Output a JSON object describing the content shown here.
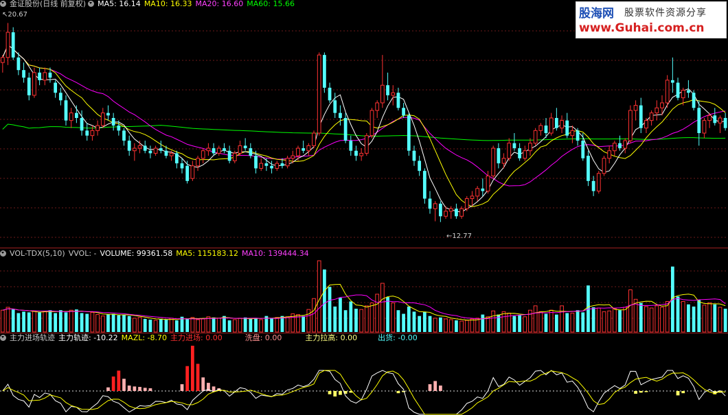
{
  "header_main": {
    "title": "金证股份(日线 前复权)",
    "ma5": "MA5: 16.14",
    "ma10": "MA10: 16.33",
    "ma20": "MA20: 16.60",
    "ma60": "MA60: 15.66"
  },
  "header_vol": {
    "title": "VOL-TDX(5,10)",
    "vvol": "VVOL: -",
    "volume": "VOLUME: 99361.58",
    "ma5": "MA5: 115183.12",
    "ma10": "MA10: 139444.34"
  },
  "header_ind": {
    "title": "主力进场轨迹",
    "track": "主力轨迹: -10.22",
    "mazl": "MAZL: -8.70",
    "enter": "主力进场: 0.00",
    "wash": "洗盘: 0.00",
    "pull": "主力拉高: 0.00",
    "exit": "出货: -0.00"
  },
  "logo": {
    "name": "股海网",
    "slogan": "股票软件资源分享",
    "url": "www.Guhai.com.cn"
  },
  "colors": {
    "background": "#000000",
    "up": "#ff3232",
    "down": "#54ffff",
    "ma5": "#ffffff",
    "ma10": "#ffff00",
    "ma20": "#ff00ff",
    "ma60": "#00ff00",
    "grid": "#6e1a1a",
    "enter_bar": "#ff2020",
    "wash_bar": "#ffb0b0",
    "pull_bar": "#ffff80",
    "exit_bar": "#ffff66"
  },
  "chart_data": {
    "type": "candlestick",
    "max_label": "20.67",
    "min_label": "12.77",
    "price_range": [
      12.0,
      21.2
    ],
    "candles": [
      [
        19.1,
        19.4,
        18.7,
        19.3
      ],
      [
        19.3,
        20.67,
        19.0,
        20.3
      ],
      [
        20.3,
        20.5,
        19.2,
        19.3
      ],
      [
        19.3,
        19.5,
        18.6,
        18.8
      ],
      [
        18.8,
        19.1,
        18.3,
        18.5
      ],
      [
        18.5,
        18.7,
        17.6,
        17.8
      ],
      [
        17.8,
        18.9,
        17.7,
        18.7
      ],
      [
        18.7,
        18.9,
        18.2,
        18.4
      ],
      [
        18.4,
        18.9,
        18.2,
        18.7
      ],
      [
        18.7,
        18.9,
        18.3,
        18.5
      ],
      [
        18.3,
        18.4,
        17.7,
        17.9
      ],
      [
        17.9,
        18.1,
        17.4,
        17.6
      ],
      [
        17.6,
        17.8,
        16.6,
        16.8
      ],
      [
        16.8,
        17.3,
        16.5,
        17.1
      ],
      [
        17.1,
        17.4,
        16.7,
        16.9
      ],
      [
        16.9,
        17.2,
        16.2,
        16.4
      ],
      [
        16.4,
        16.7,
        16.0,
        16.2
      ],
      [
        16.2,
        16.6,
        16.0,
        16.4
      ],
      [
        16.4,
        16.8,
        16.2,
        16.6
      ],
      [
        16.6,
        17.3,
        16.5,
        17.1
      ],
      [
        17.1,
        17.4,
        16.8,
        17.0
      ],
      [
        16.9,
        17.1,
        16.4,
        16.6
      ],
      [
        16.6,
        16.8,
        16.2,
        16.4
      ],
      [
        16.4,
        16.5,
        15.8,
        16.0
      ],
      [
        16.0,
        16.2,
        15.4,
        15.6
      ],
      [
        15.6,
        15.9,
        15.2,
        15.7
      ],
      [
        15.7,
        16.0,
        15.5,
        15.8
      ],
      [
        15.8,
        16.0,
        15.5,
        15.6
      ],
      [
        15.6,
        15.8,
        15.3,
        15.5
      ],
      [
        15.5,
        15.8,
        15.4,
        15.7
      ],
      [
        15.7,
        16.0,
        15.5,
        15.6
      ],
      [
        15.6,
        15.8,
        15.3,
        15.4
      ],
      [
        15.4,
        15.6,
        15.2,
        15.5
      ],
      [
        15.5,
        15.6,
        14.9,
        15.1
      ],
      [
        15.1,
        15.3,
        14.7,
        14.9
      ],
      [
        15.0,
        15.2,
        14.3,
        14.4
      ],
      [
        14.5,
        15.2,
        14.4,
        15.0
      ],
      [
        15.0,
        15.4,
        14.8,
        15.3
      ],
      [
        15.3,
        15.7,
        15.1,
        15.6
      ],
      [
        15.6,
        15.9,
        15.4,
        15.7
      ],
      [
        15.7,
        15.9,
        15.4,
        15.5
      ],
      [
        15.5,
        15.8,
        15.4,
        15.7
      ],
      [
        15.7,
        15.9,
        15.5,
        15.6
      ],
      [
        15.6,
        15.8,
        15.1,
        15.2
      ],
      [
        15.2,
        15.6,
        15.1,
        15.5
      ],
      [
        15.5,
        16.0,
        15.4,
        15.8
      ],
      [
        15.8,
        16.1,
        15.6,
        15.7
      ],
      [
        15.7,
        15.9,
        15.3,
        15.4
      ],
      [
        15.4,
        15.6,
        14.7,
        14.9
      ],
      [
        14.9,
        15.3,
        14.8,
        15.1
      ],
      [
        15.1,
        15.3,
        14.8,
        15.0
      ],
      [
        15.0,
        15.2,
        14.7,
        14.9
      ],
      [
        14.9,
        15.2,
        14.8,
        15.1
      ],
      [
        15.1,
        15.3,
        14.9,
        15.0
      ],
      [
        15.0,
        15.4,
        14.9,
        15.3
      ],
      [
        15.3,
        15.6,
        15.1,
        15.4
      ],
      [
        15.4,
        15.8,
        15.2,
        15.7
      ],
      [
        15.7,
        16.0,
        15.5,
        15.6
      ],
      [
        15.6,
        15.9,
        15.4,
        15.8
      ],
      [
        15.8,
        16.4,
        15.7,
        16.3
      ],
      [
        16.3,
        19.5,
        16.2,
        19.4
      ],
      [
        19.4,
        19.5,
        17.9,
        18.1
      ],
      [
        18.1,
        18.3,
        17.5,
        17.6
      ],
      [
        17.6,
        17.9,
        16.9,
        17.1
      ],
      [
        17.1,
        17.4,
        16.6,
        16.9
      ],
      [
        16.9,
        17.1,
        15.9,
        16.0
      ],
      [
        16.0,
        16.2,
        15.4,
        15.6
      ],
      [
        15.6,
        15.8,
        15.2,
        15.4
      ],
      [
        15.4,
        15.7,
        15.2,
        15.5
      ],
      [
        15.5,
        16.3,
        15.4,
        16.2
      ],
      [
        16.2,
        17.3,
        16.1,
        17.2
      ],
      [
        17.2,
        17.6,
        16.9,
        17.5
      ],
      [
        17.5,
        19.4,
        17.3,
        18.2
      ],
      [
        18.2,
        18.7,
        17.6,
        17.8
      ],
      [
        17.8,
        18.2,
        17.4,
        17.9
      ],
      [
        17.9,
        18.1,
        17.2,
        17.3
      ],
      [
        17.3,
        17.5,
        16.9,
        17.0
      ],
      [
        17.0,
        17.1,
        15.4,
        15.6
      ],
      [
        15.6,
        15.8,
        15.0,
        15.2
      ],
      [
        15.2,
        15.4,
        14.6,
        14.8
      ],
      [
        14.8,
        14.9,
        13.5,
        13.7
      ],
      [
        13.7,
        14.0,
        13.1,
        13.3
      ],
      [
        13.3,
        13.6,
        12.8,
        13.5
      ],
      [
        13.5,
        13.6,
        12.77,
        13.0
      ],
      [
        13.0,
        13.4,
        12.9,
        13.2
      ],
      [
        13.2,
        13.4,
        12.9,
        13.3
      ],
      [
        13.3,
        13.5,
        12.9,
        13.0
      ],
      [
        13.0,
        13.4,
        12.9,
        13.3
      ],
      [
        13.3,
        13.8,
        13.2,
        13.7
      ],
      [
        13.7,
        14.0,
        13.4,
        13.8
      ],
      [
        13.8,
        14.2,
        13.6,
        14.1
      ],
      [
        14.1,
        14.5,
        13.8,
        14.0
      ],
      [
        14.0,
        14.8,
        13.9,
        14.6
      ],
      [
        14.6,
        15.8,
        14.5,
        15.7
      ],
      [
        15.7,
        15.9,
        14.9,
        15.1
      ],
      [
        15.1,
        15.5,
        14.9,
        15.3
      ],
      [
        15.3,
        16.1,
        15.2,
        15.9
      ],
      [
        15.9,
        16.3,
        15.6,
        15.7
      ],
      [
        15.7,
        15.9,
        15.2,
        15.3
      ],
      [
        15.3,
        15.8,
        15.2,
        15.6
      ],
      [
        15.6,
        16.1,
        15.4,
        15.9
      ],
      [
        15.9,
        16.5,
        15.8,
        16.4
      ],
      [
        16.4,
        16.7,
        16.2,
        16.6
      ],
      [
        16.6,
        16.9,
        16.1,
        16.3
      ],
      [
        16.3,
        17.1,
        16.2,
        16.9
      ],
      [
        16.9,
        17.3,
        16.4,
        16.5
      ],
      [
        16.5,
        17.0,
        16.3,
        16.8
      ],
      [
        16.8,
        17.1,
        16.1,
        16.2
      ],
      [
        16.2,
        16.6,
        15.9,
        16.4
      ],
      [
        16.4,
        16.5,
        15.8,
        16.0
      ],
      [
        16.0,
        16.3,
        15.2,
        15.3
      ],
      [
        15.4,
        15.6,
        14.2,
        14.4
      ],
      [
        14.4,
        14.6,
        13.8,
        14.0
      ],
      [
        14.0,
        14.8,
        13.9,
        14.7
      ],
      [
        14.7,
        15.4,
        14.6,
        15.3
      ],
      [
        15.3,
        15.8,
        15.1,
        15.6
      ],
      [
        15.6,
        16.0,
        15.4,
        15.9
      ],
      [
        15.9,
        16.2,
        15.6,
        15.7
      ],
      [
        15.7,
        16.1,
        15.5,
        16.0
      ],
      [
        16.0,
        17.4,
        15.9,
        17.2
      ],
      [
        17.2,
        17.6,
        16.8,
        17.4
      ],
      [
        17.4,
        17.7,
        16.3,
        16.5
      ],
      [
        16.5,
        16.9,
        16.3,
        16.8
      ],
      [
        16.8,
        17.2,
        16.6,
        17.1
      ],
      [
        17.1,
        17.6,
        16.8,
        17.3
      ],
      [
        17.3,
        17.8,
        17.0,
        17.5
      ],
      [
        17.5,
        18.6,
        17.3,
        18.4
      ],
      [
        18.4,
        19.3,
        17.9,
        18.3
      ],
      [
        18.3,
        18.5,
        17.6,
        17.7
      ],
      [
        17.7,
        18.1,
        17.4,
        18.0
      ],
      [
        18.0,
        18.4,
        17.7,
        17.9
      ],
      [
        17.9,
        18.0,
        17.2,
        17.3
      ],
      [
        17.3,
        17.6,
        15.8,
        16.3
      ],
      [
        16.3,
        16.9,
        16.1,
        16.8
      ],
      [
        16.8,
        17.1,
        16.5,
        17.0
      ],
      [
        17.0,
        17.3,
        16.6,
        16.7
      ],
      [
        16.7,
        17.0,
        16.3,
        16.9
      ],
      [
        16.9,
        17.1,
        16.4,
        16.5
      ]
    ],
    "volume": [
      0.3,
      0.34,
      0.31,
      0.26,
      0.28,
      0.27,
      0.29,
      0.27,
      0.28,
      0.3,
      0.26,
      0.3,
      0.27,
      0.3,
      0.31,
      0.26,
      0.25,
      0.27,
      0.24,
      0.22,
      0.24,
      0.25,
      0.23,
      0.24,
      0.22,
      0.19,
      0.2,
      0.18,
      0.17,
      0.16,
      0.18,
      0.17,
      0.19,
      0.16,
      0.21,
      0.18,
      0.2,
      0.17,
      0.18,
      0.21,
      0.2,
      0.19,
      0.22,
      0.16,
      0.17,
      0.19,
      0.2,
      0.18,
      0.19,
      0.17,
      0.22,
      0.19,
      0.2,
      0.22,
      0.21,
      0.25,
      0.24,
      0.22,
      0.31,
      0.46,
      0.98,
      0.86,
      0.62,
      0.35,
      0.47,
      0.3,
      0.42,
      0.32,
      0.31,
      0.36,
      0.4,
      0.52,
      0.67,
      0.48,
      0.4,
      0.3,
      0.25,
      0.35,
      0.28,
      0.22,
      0.28,
      0.22,
      0.19,
      0.2,
      0.18,
      0.17,
      0.16,
      0.15,
      0.16,
      0.18,
      0.19,
      0.24,
      0.21,
      0.29,
      0.24,
      0.28,
      0.26,
      0.22,
      0.23,
      0.21,
      0.3,
      0.36,
      0.28,
      0.25,
      0.3,
      0.24,
      0.36,
      0.26,
      0.26,
      0.3,
      0.27,
      0.64,
      0.34,
      0.33,
      0.28,
      0.29,
      0.32,
      0.3,
      0.34,
      0.58,
      0.45,
      0.4,
      0.35,
      0.33,
      0.36,
      0.34,
      0.42,
      0.9,
      0.49,
      0.42,
      0.38,
      0.35,
      0.44,
      0.37,
      0.4,
      0.38,
      0.34,
      0.32
    ],
    "enter": [
      0,
      0,
      0,
      0,
      0,
      0,
      0,
      0,
      0,
      0,
      0,
      0,
      0,
      0,
      0,
      0,
      0,
      0,
      0,
      0,
      0.08,
      0.32,
      0.45,
      0.27,
      0.12,
      0.1,
      0.09,
      0.07,
      0.06,
      0,
      0,
      0,
      0,
      0,
      0.15,
      0.55,
      1.0,
      0.6,
      0.3,
      0.18,
      0.1,
      0.06,
      0,
      0,
      0,
      0,
      0,
      0,
      0,
      0,
      0,
      0,
      0,
      0,
      0,
      0,
      0,
      0,
      0,
      0,
      0,
      0,
      0,
      0,
      0,
      0,
      0,
      0,
      0,
      0,
      0,
      0,
      0,
      0,
      0,
      0,
      0,
      0,
      0,
      0,
      0,
      0.15,
      0.22,
      0.12,
      0,
      0,
      0,
      0,
      0,
      0,
      0,
      0,
      0,
      0,
      0,
      0,
      0,
      0,
      0,
      0,
      0,
      0,
      0,
      0,
      0,
      0,
      0,
      0,
      0,
      0,
      0,
      0,
      0,
      0,
      0,
      0,
      0,
      0,
      0,
      0,
      0,
      0,
      0,
      0,
      0,
      0,
      0,
      0,
      0,
      0,
      0,
      0,
      0,
      0,
      0,
      0,
      0,
      0
    ],
    "pull": [
      0,
      0,
      0,
      0,
      0,
      0,
      0,
      0,
      0,
      0,
      0,
      0,
      0,
      0,
      0,
      0,
      0,
      0,
      0,
      0,
      0,
      0,
      0,
      0,
      0,
      0,
      0,
      0,
      0,
      0,
      0,
      0,
      0,
      0,
      0,
      0,
      0,
      0,
      0,
      0,
      0,
      0,
      0,
      0,
      0,
      0,
      0,
      0,
      0,
      0,
      0,
      0,
      0,
      0,
      0,
      0,
      0,
      0,
      0,
      0,
      0,
      0,
      0,
      0,
      0,
      0,
      0,
      0,
      0,
      0,
      0,
      0,
      0,
      0,
      0,
      0,
      0,
      0,
      0,
      0,
      0,
      0,
      0,
      0,
      0,
      0,
      0,
      0,
      0,
      0,
      0,
      0,
      0,
      0,
      0,
      0,
      0,
      0,
      0,
      0,
      0,
      0,
      0,
      0,
      0,
      0,
      0,
      0,
      0,
      0,
      0,
      0,
      0,
      0,
      0,
      0,
      0,
      0,
      0,
      0,
      0,
      0,
      0,
      0,
      0,
      0,
      0,
      0,
      0,
      0,
      0,
      0,
      0,
      0,
      0,
      0,
      0,
      0
    ],
    "exit": [
      0,
      0,
      0,
      0,
      0,
      0,
      0,
      0,
      0,
      0,
      0,
      0,
      0,
      0,
      0,
      0,
      0,
      0,
      0,
      0,
      0,
      0,
      0,
      0,
      0,
      0,
      0,
      0,
      0,
      0,
      0,
      0,
      0,
      0,
      0,
      0,
      0,
      0,
      0,
      0,
      0,
      0,
      0,
      0,
      0,
      0,
      0,
      0,
      0,
      0,
      0,
      0,
      0,
      0,
      0,
      0,
      0,
      0,
      0,
      0,
      0,
      0,
      0.6,
      1.0,
      0.7,
      0.5,
      0.3,
      0,
      0,
      0,
      0,
      0,
      0,
      0,
      0,
      0.4,
      0.2,
      0,
      0,
      0,
      0,
      0,
      0,
      0,
      0,
      0,
      0,
      0,
      0,
      0,
      0,
      0,
      0,
      0,
      0,
      0,
      0,
      0,
      0,
      0,
      0,
      0,
      0,
      0,
      0,
      0,
      0,
      0,
      0,
      0,
      0,
      0,
      0,
      0,
      0,
      0,
      0,
      0,
      0,
      0,
      0.5,
      0.3,
      0.2,
      0,
      0,
      0,
      0,
      0,
      0.8,
      0.4,
      0,
      0,
      0,
      0,
      0,
      0.6,
      0.3,
      0
    ]
  }
}
